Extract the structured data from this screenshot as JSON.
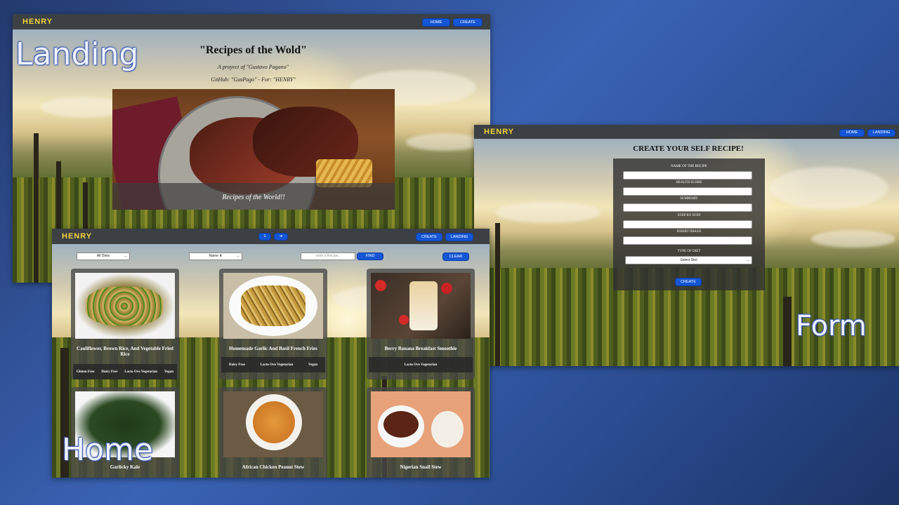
{
  "landing": {
    "logo": "HENRY",
    "nav": {
      "home": "HOME",
      "create": "CREATE"
    },
    "label": "Landing",
    "title": "\"Recipes of the Wold\"",
    "subtitle": "A proyect of \"Gustavo Pagano\"",
    "github": "GitHub: \"GusPago\" - For: \"HENRY\"",
    "caption": "Recipes of the World!!"
  },
  "form": {
    "logo": "HENRY",
    "nav": {
      "home": "HOME",
      "landing": "LANDING"
    },
    "label": "Form",
    "title": "CREATE YOUR SELF RECIPE!",
    "fields": {
      "name": "NAME OF THE RECIPE",
      "health": "HEALTH SCORE",
      "summary": "SUMMARY",
      "steps": "STEP BY STEP",
      "image": "INSERT IMAGE",
      "diet": "TYPE OF DIET"
    },
    "diet_select": "Select Diet",
    "submit": "CREATE"
  },
  "home": {
    "logo": "HENRY",
    "label": "Home",
    "pagination": {
      "page": "1",
      "next": "➜"
    },
    "nav": {
      "create": "CREATE",
      "landing": "LANDING"
    },
    "filters": {
      "diets": "All Diets",
      "sort": "Name ⬍",
      "search_placeholder": "write a Recipe..",
      "find": "FIND",
      "clear": "CLEAR"
    },
    "cards": [
      {
        "title": "Cauliflower, Brown Rice, And Vegetable Fried Rice",
        "diets": [
          "Gluten Free",
          "Dairy Free",
          "Lacto Ovo Vegetarian",
          "Vegan"
        ]
      },
      {
        "title": "Homemade Garlic And Basil French Fries",
        "diets": [
          "Dairy Free",
          "Lacto Ovo Vegetarian",
          "Vegan"
        ]
      },
      {
        "title": "Berry Banana Breakfast Smoothie",
        "diets": [
          "Lacto Ovo Vegetarian"
        ]
      },
      {
        "title": "Garlicky Kale",
        "diets": []
      },
      {
        "title": "African Chicken Peanut Stew",
        "diets": []
      },
      {
        "title": "Nigerian Snail Stew",
        "diets": []
      }
    ]
  }
}
